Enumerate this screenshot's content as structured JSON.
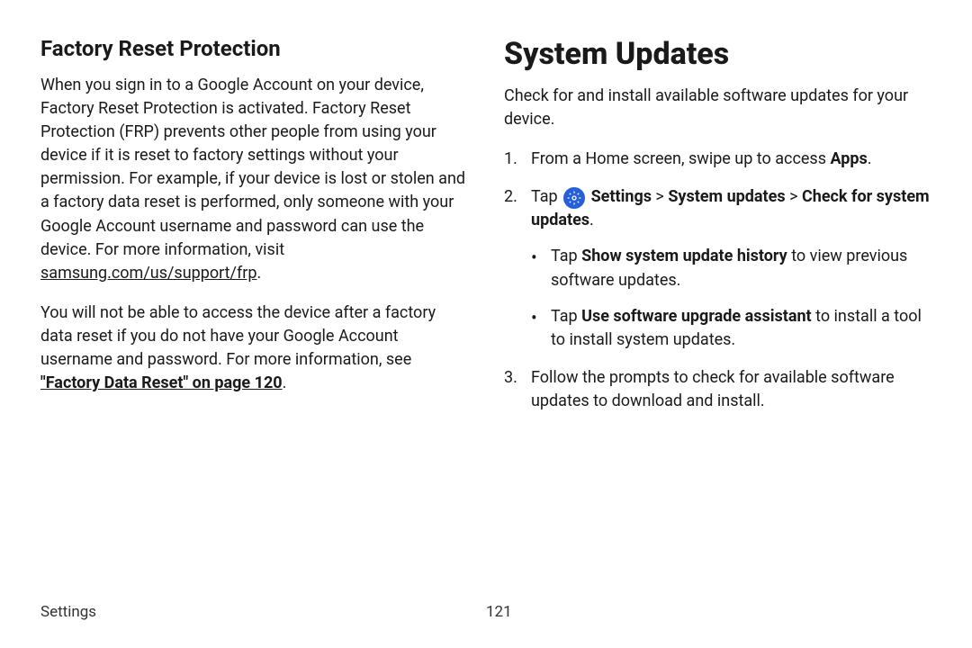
{
  "left": {
    "heading": "Factory Reset Protection",
    "para1_a": "When you sign in to a Google Account on your device, Factory Reset Protection is activated. Factory Reset Protection (FRP) prevents other people from using your device if it is reset to factory settings without your permission. For example, if your device is lost or stolen and a factory data reset is performed, only someone with your Google Account username and password can use the device. For more information, visit ",
    "para1_link": "samsung.com/us/support/frp",
    "para1_b": ".",
    "para2_a": "You will not be able to access the device after a factory data reset if you do not have your Google Account username and password. For more information, see ",
    "para2_link": "\"Factory Data Reset\" on page 120",
    "para2_b": "."
  },
  "right": {
    "heading": "System Updates",
    "intro": "Check for and install available software updates for your device.",
    "step1_a": "From a Home screen, swipe up to access ",
    "step1_b": "Apps",
    "step1_c": ".",
    "step2_a": "Tap ",
    "step2_b": " Settings",
    "step2_c": " > ",
    "step2_d": "System updates",
    "step2_e": " > ",
    "step2_f": "Check for system updates",
    "step2_g": ".",
    "bullet1_a": "Tap ",
    "bullet1_b": "Show system update history",
    "bullet1_c": " to view previous software updates.",
    "bullet2_a": "Tap ",
    "bullet2_b": "Use software upgrade assistant",
    "bullet2_c": " to install a tool to install system updates.",
    "step3": "Follow the prompts to check for available software updates to download and install."
  },
  "footer": {
    "section": "Settings",
    "page": "121"
  }
}
